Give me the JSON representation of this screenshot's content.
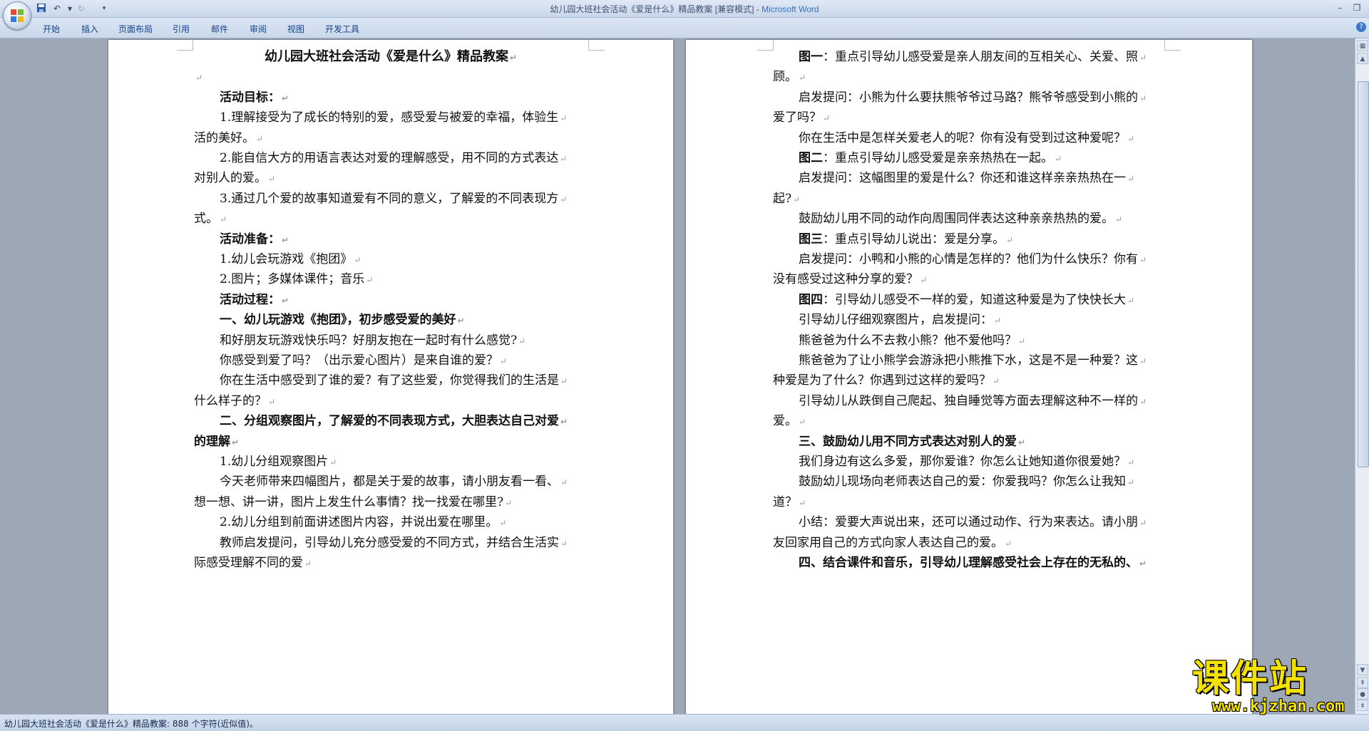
{
  "window": {
    "title": "幼儿园大班社会活动《爱是什么》精品教案 [兼容模式] - ",
    "app_name": "Microsoft Word"
  },
  "quick_access": {
    "icons": [
      "save-icon",
      "undo-icon",
      "redo-icon",
      "customize-icon"
    ]
  },
  "ribbon_tabs": [
    "开始",
    "插入",
    "页面布局",
    "引用",
    "邮件",
    "审阅",
    "视图",
    "开发工具"
  ],
  "status_bar": {
    "text": "幼儿园大班社会活动《爱是什么》精品教案: 888 个字符(近似值)。"
  },
  "watermark": {
    "title": "课件站",
    "url": "www.kjzhan.com"
  },
  "pages": {
    "left": [
      {
        "text": "幼儿园大班社会活动《爱是什么》精品教案",
        "style": "title"
      },
      {
        "text": "",
        "style": "empty"
      },
      {
        "text": "活动目标：",
        "style": "heading"
      },
      {
        "text": "1.理解接受为了成长的特别的爱，感受爱与被爱的幸福，体验生",
        "style": "first"
      },
      {
        "text": "活的美好。",
        "style": "cont"
      },
      {
        "text": "2.能自信大方的用语言表达对爱的理解感受，用不同的方式表达",
        "style": "first"
      },
      {
        "text": "对别人的爱。",
        "style": "cont"
      },
      {
        "text": "3.通过几个爱的故事知道爱有不同的意义，了解爱的不同表现方",
        "style": "first"
      },
      {
        "text": "式。",
        "style": "cont"
      },
      {
        "text": "活动准备：",
        "style": "heading"
      },
      {
        "text": "1.幼儿会玩游戏《抱团》",
        "style": "first"
      },
      {
        "text": "2.图片；多媒体课件；音乐",
        "style": "first"
      },
      {
        "text": "活动过程：",
        "style": "heading"
      },
      {
        "text": "一、幼儿玩游戏《抱团》，初步感受爱的美好",
        "style": "heading"
      },
      {
        "text": "和好朋友玩游戏快乐吗？好朋友抱在一起时有什么感觉?",
        "style": "first"
      },
      {
        "text": "你感受到爱了吗？（出示爱心图片）是来自谁的爱？",
        "style": "first"
      },
      {
        "text": "你在生活中感受到了谁的爱？有了这些爱，你觉得我们的生活是",
        "style": "first"
      },
      {
        "text": "什么样子的？",
        "style": "cont"
      },
      {
        "text": "二、分组观察图片，了解爱的不同表现方式，大胆表达自己对爱",
        "style": "heading"
      },
      {
        "text": "的理解",
        "style": "headcont"
      },
      {
        "text": "1.幼儿分组观察图片",
        "style": "first"
      },
      {
        "text": "今天老师带来四幅图片，都是关于爱的故事，请小朋友看一看、",
        "style": "first"
      },
      {
        "text": "想一想、讲一讲，图片上发生什么事情？找一找爱在哪里?",
        "style": "cont"
      },
      {
        "text": "2.幼儿分组到前面讲述图片内容，并说出爱在哪里。",
        "style": "first"
      },
      {
        "text": "教师启发提问，引导幼儿充分感受爱的不同方式，并结合生活实",
        "style": "first"
      },
      {
        "text": "际感受理解不同的爱",
        "style": "cont"
      }
    ],
    "right": [
      {
        "text": "图一：重点引导幼儿感受爱是亲人朋友间的互相关心、关爱、照",
        "style": "first",
        "bold_prefix": "图一"
      },
      {
        "text": "顾。",
        "style": "cont"
      },
      {
        "text": "启发提问：小熊为什么要扶熊爷爷过马路？熊爷爷感受到小熊的",
        "style": "first"
      },
      {
        "text": "爱了吗？",
        "style": "cont"
      },
      {
        "text": "你在生活中是怎样关爱老人的呢？你有没有受到过这种爱呢？",
        "style": "first"
      },
      {
        "text": "图二：重点引导幼儿感受爱是亲亲热热在一起。",
        "style": "first",
        "bold_prefix": "图二"
      },
      {
        "text": "启发提问：这幅图里的爱是什么？你还和谁这样亲亲热热在一",
        "style": "first"
      },
      {
        "text": "起?",
        "style": "cont"
      },
      {
        "text": "鼓励幼儿用不同的动作向周围同伴表达这种亲亲热热的爱。",
        "style": "first"
      },
      {
        "text": "图三：重点引导幼儿说出：爱是分享。",
        "style": "first",
        "bold_prefix": "图三"
      },
      {
        "text": "启发提问：小鸭和小熊的心情是怎样的？他们为什么快乐？你有",
        "style": "first"
      },
      {
        "text": "没有感受过这种分享的爱？",
        "style": "cont"
      },
      {
        "text": "图四：引导幼儿感受不一样的爱，知道这种爱是为了快快长大",
        "style": "first",
        "bold_prefix": "图四"
      },
      {
        "text": "引导幼儿仔细观察图片，启发提问：",
        "style": "first"
      },
      {
        "text": "熊爸爸为什么不去救小熊？他不爱他吗？",
        "style": "first"
      },
      {
        "text": "熊爸爸为了让小熊学会游泳把小熊推下水，这是不是一种爱？这",
        "style": "first"
      },
      {
        "text": "种爱是为了什么？你遇到过这样的爱吗？",
        "style": "cont"
      },
      {
        "text": "引导幼儿从跌倒自己爬起、独自睡觉等方面去理解这种不一样的",
        "style": "first"
      },
      {
        "text": "爱。",
        "style": "cont"
      },
      {
        "text": "三、鼓励幼儿用不同方式表达对别人的爱",
        "style": "heading"
      },
      {
        "text": "我们身边有这么多爱，那你爱谁？你怎么让她知道你很爱她？",
        "style": "first"
      },
      {
        "text": "鼓励幼儿现场向老师表达自己的爱：你爱我吗？你怎么让我知",
        "style": "first"
      },
      {
        "text": "道？",
        "style": "cont"
      },
      {
        "text": "小结：爱要大声说出来，还可以通过动作、行为来表达。请小朋",
        "style": "first"
      },
      {
        "text": "友回家用自己的方式向家人表达自己的爱。",
        "style": "cont"
      },
      {
        "text": "四、结合课件和音乐，引导幼儿理解感受社会上存在的无私的、",
        "style": "heading"
      }
    ]
  },
  "paragraph_mark": "↵"
}
